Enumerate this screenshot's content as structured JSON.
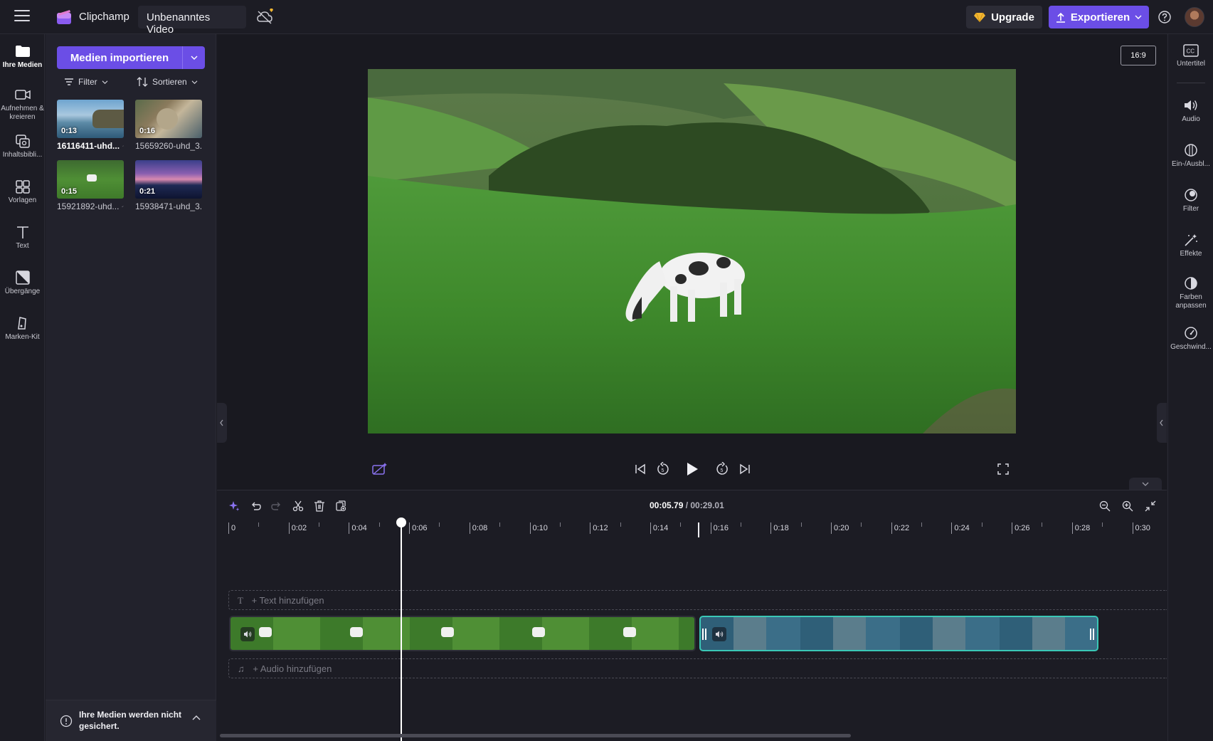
{
  "topbar": {
    "app_name": "Clipchamp",
    "project_title": "Unbenanntes Video",
    "upgrade_label": "Upgrade",
    "export_label": "Exportieren"
  },
  "left_rail": {
    "items": [
      {
        "label": "Ihre Medien",
        "icon": "folder-icon"
      },
      {
        "label": "Aufnehmen & kreieren",
        "icon": "camera-icon"
      },
      {
        "label": "Inhaltsbibli...",
        "icon": "library-icon"
      },
      {
        "label": "Vorlagen",
        "icon": "templates-icon"
      },
      {
        "label": "Text",
        "icon": "text-icon"
      },
      {
        "label": "Übergänge",
        "icon": "transitions-icon"
      },
      {
        "label": "Marken-Kit",
        "icon": "brand-kit-icon"
      }
    ]
  },
  "media": {
    "import_label": "Medien importieren",
    "filter_label": "Filter",
    "sort_label": "Sortieren",
    "items": [
      {
        "duration": "0:13",
        "name": "16116411-uhd...",
        "checked": true
      },
      {
        "duration": "0:16",
        "name": "15659260-uhd_3...",
        "checked": false
      },
      {
        "duration": "0:15",
        "name": "15921892-uhd...",
        "checked": true
      },
      {
        "duration": "0:21",
        "name": "15938471-uhd_3...",
        "checked": false
      }
    ],
    "notice": "Ihre Medien werden nicht gesichert."
  },
  "preview": {
    "aspect_ratio": "16:9"
  },
  "right_rail": {
    "items": [
      {
        "label": "Untertitel",
        "icon": "captions-icon"
      },
      {
        "label": "Audio",
        "icon": "audio-icon"
      },
      {
        "label": "Ein-/Ausbl...",
        "icon": "fade-icon"
      },
      {
        "label": "Filter",
        "icon": "filter-icon"
      },
      {
        "label": "Effekte",
        "icon": "effects-icon"
      },
      {
        "label": "Farben anpassen",
        "icon": "color-adjust-icon"
      },
      {
        "label": "Geschwind...",
        "icon": "speed-icon"
      }
    ]
  },
  "timeline": {
    "current_time": "00:05.79",
    "total_time": "/ 00:29.01",
    "ruler_labels": [
      "0",
      "0:02",
      "0:04",
      "0:06",
      "0:08",
      "0:10",
      "0:12",
      "0:14",
      "0:16",
      "0:18",
      "0:20",
      "0:22",
      "0:24",
      "0:26",
      "0:28",
      "0:30"
    ],
    "text_track_label": "+ Text hinzufügen",
    "audio_track_label": "+ Audio hinzufügen"
  },
  "colors": {
    "accent": "#6b4ee6",
    "selected_clip_border": "#3ac7b6",
    "background": "#1c1c24"
  }
}
